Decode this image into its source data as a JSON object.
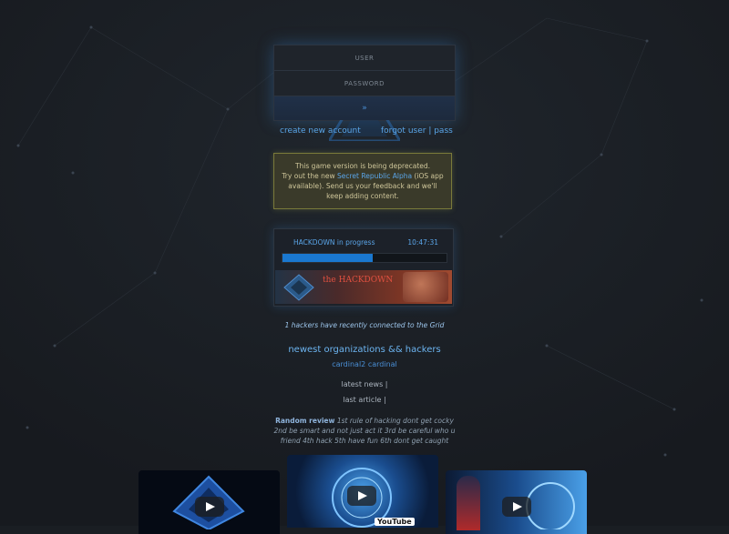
{
  "login": {
    "user_placeholder": "USER",
    "password_placeholder": "PASSWORD",
    "submit_label": "»",
    "create_account": "create new account",
    "forgot": "forgot user | pass"
  },
  "notice": {
    "line1": "This game version is being deprecated.",
    "line2_prefix": "Try out the new ",
    "line2_link": "Secret Republic Alpha",
    "line2_suffix": " (iOS app available). Send us your feedback and we'll keep adding content."
  },
  "event": {
    "title": "HACKDOWN in progress",
    "timer": "10:47:31",
    "progress": 0.55,
    "banner_title": "the HACKDOWN"
  },
  "stats": {
    "connected": "1 hackers have recently connected to the Grid"
  },
  "newest": {
    "heading": "newest organizations && hackers",
    "names": "cardinal2 cardinal"
  },
  "links": {
    "latest_news": "latest news |",
    "last_article": "last article |"
  },
  "review": {
    "label": "Random review",
    "text": "1st rule of hacking dont get cocky 2nd be smart and not just act it 3rd be careful who u friend 4th hack 5th have fun 6th dont get caught"
  },
  "videos": {
    "youtube_label": "YouTube"
  },
  "colors": {
    "accent": "#5aa5e8",
    "progress": "#1a78d0",
    "notice_border": "#7a7a3a"
  }
}
